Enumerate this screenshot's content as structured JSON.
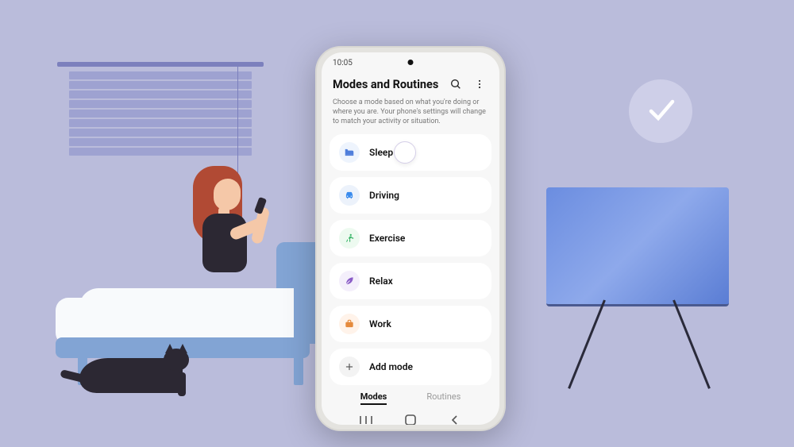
{
  "status": {
    "time": "10:05"
  },
  "header": {
    "title": "Modes and Routines",
    "subtitle": "Choose a mode based on what you're doing or where you are. Your phone's settings will change to match your activity or situation."
  },
  "modes": {
    "items": [
      {
        "label": "Sleep",
        "icon": "bed-icon"
      },
      {
        "label": "Driving",
        "icon": "car-icon"
      },
      {
        "label": "Exercise",
        "icon": "run-icon"
      },
      {
        "label": "Relax",
        "icon": "leaf-icon"
      },
      {
        "label": "Work",
        "icon": "briefcase-icon"
      }
    ],
    "add": {
      "label": "Add mode"
    }
  },
  "tabs": {
    "modes": {
      "label": "Modes"
    },
    "routines": {
      "label": "Routines"
    }
  }
}
